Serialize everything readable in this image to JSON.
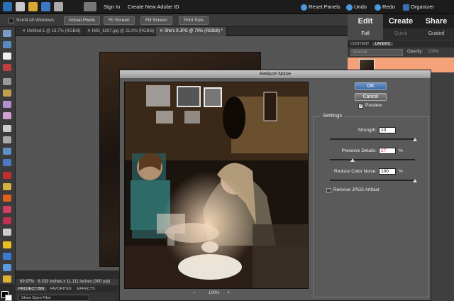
{
  "topbar": {
    "sign_in": "Sign In",
    "create_id": "Create New Adobe ID",
    "reset_panels": "Reset Panels",
    "undo": "Undo",
    "redo": "Redo",
    "organizer": "Organizer"
  },
  "options": {
    "scroll_all": "Scroll All Windows",
    "actual_pixels": "Actual Pixels",
    "fit_screen": "Fit Screen",
    "fill_screen": "Fill Screen",
    "print_size": "Print Size"
  },
  "doc_tabs": [
    {
      "label": "Untitled-1 @ 16.7% (RGB/8)"
    },
    {
      "label": "IMG_6297.jpg @ 21.9% (RGB/8)"
    },
    {
      "label": "She's 9.JPG @ 70% (RGB/8) *"
    }
  ],
  "status": {
    "zoom": "69.97%",
    "size": "8.333 inches x 11.111 inches (300 ppi)"
  },
  "bin": {
    "tabs": [
      "PROJECT BIN",
      "FAVORITES",
      "EFFECTS"
    ],
    "show": "Show Open Files"
  },
  "modes": {
    "edit": "Edit",
    "create": "Create",
    "share": "Share",
    "full": "Full",
    "quick": "Quick",
    "guided": "Guided"
  },
  "layers_panel": {
    "content_tab": "CONTENT",
    "layers_tab": "LAYERS",
    "blend_mode": "Normal",
    "opacity_label": "Opacity:",
    "opacity_value": "100%"
  },
  "dialog": {
    "title": "Reduce Noise",
    "ok": "OK",
    "cancel": "Cancel",
    "preview_label": "Preview",
    "settings_label": "Settings",
    "strength_label": "Strength:",
    "strength_value": "10",
    "strength_level": 1.0,
    "details_label": "Preserve Details:",
    "details_value": "27",
    "details_level": 0.27,
    "color_noise_label": "Reduce Color Noise:",
    "color_noise_value": "100",
    "color_noise_level": 1.0,
    "percent": "%",
    "jpeg_label": "Remove JPEG Artifact",
    "zoom": "100%"
  }
}
